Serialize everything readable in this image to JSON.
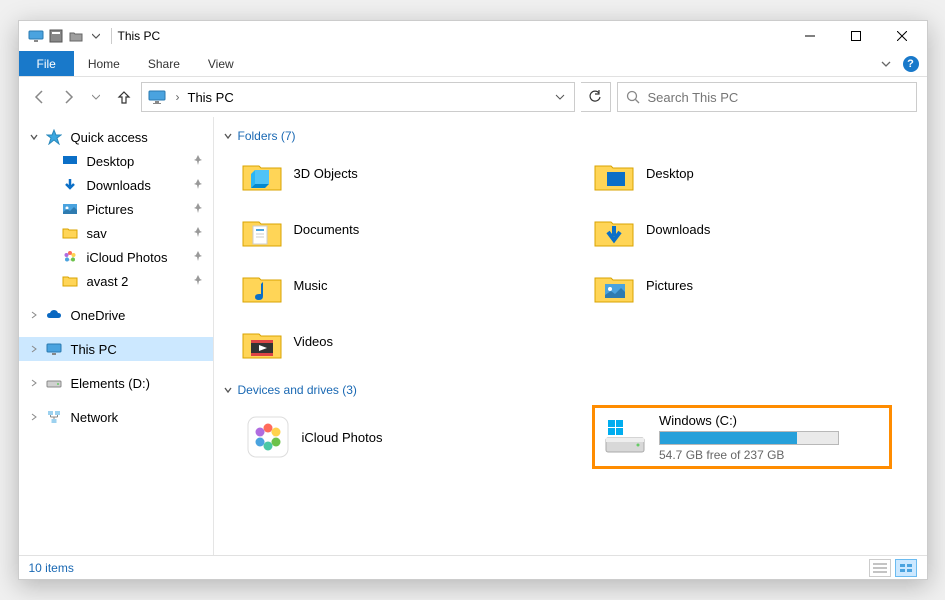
{
  "titlebar": {
    "title": "This PC"
  },
  "ribbon": {
    "file": "File",
    "tabs": [
      "Home",
      "Share",
      "View"
    ]
  },
  "navbar": {
    "path": "This PC",
    "chevron": "›"
  },
  "search": {
    "placeholder": "Search This PC"
  },
  "sidebar": {
    "quick_access": "Quick access",
    "items": [
      {
        "label": "Desktop",
        "icon": "desktop",
        "pinned": true
      },
      {
        "label": "Downloads",
        "icon": "downloads",
        "pinned": true
      },
      {
        "label": "Pictures",
        "icon": "pictures",
        "pinned": true
      },
      {
        "label": "sav",
        "icon": "folder",
        "pinned": true
      },
      {
        "label": "iCloud Photos",
        "icon": "icloud-photos",
        "pinned": true
      },
      {
        "label": "avast 2",
        "icon": "folder",
        "pinned": true
      }
    ],
    "onedrive": "OneDrive",
    "this_pc": "This PC",
    "elements": "Elements (D:)",
    "network": "Network"
  },
  "sections": {
    "folders": {
      "title": "Folders (7)"
    },
    "drives": {
      "title": "Devices and drives (3)"
    }
  },
  "folders": [
    {
      "label": "3D Objects",
      "icon": "3d"
    },
    {
      "label": "Desktop",
      "icon": "desktop-folder"
    },
    {
      "label": "Documents",
      "icon": "documents"
    },
    {
      "label": "Downloads",
      "icon": "downloads-folder"
    },
    {
      "label": "Music",
      "icon": "music"
    },
    {
      "label": "Pictures",
      "icon": "pictures-folder"
    },
    {
      "label": "Videos",
      "icon": "videos"
    }
  ],
  "drives": [
    {
      "label": "iCloud Photos",
      "icon": "icloud-photos-app",
      "type": "app"
    },
    {
      "label": "Windows (C:)",
      "icon": "drive",
      "type": "drive",
      "sub": "54.7 GB free of 237 GB",
      "fill_pct": 77,
      "highlight": true
    }
  ],
  "statusbar": {
    "count": "10 items"
  }
}
